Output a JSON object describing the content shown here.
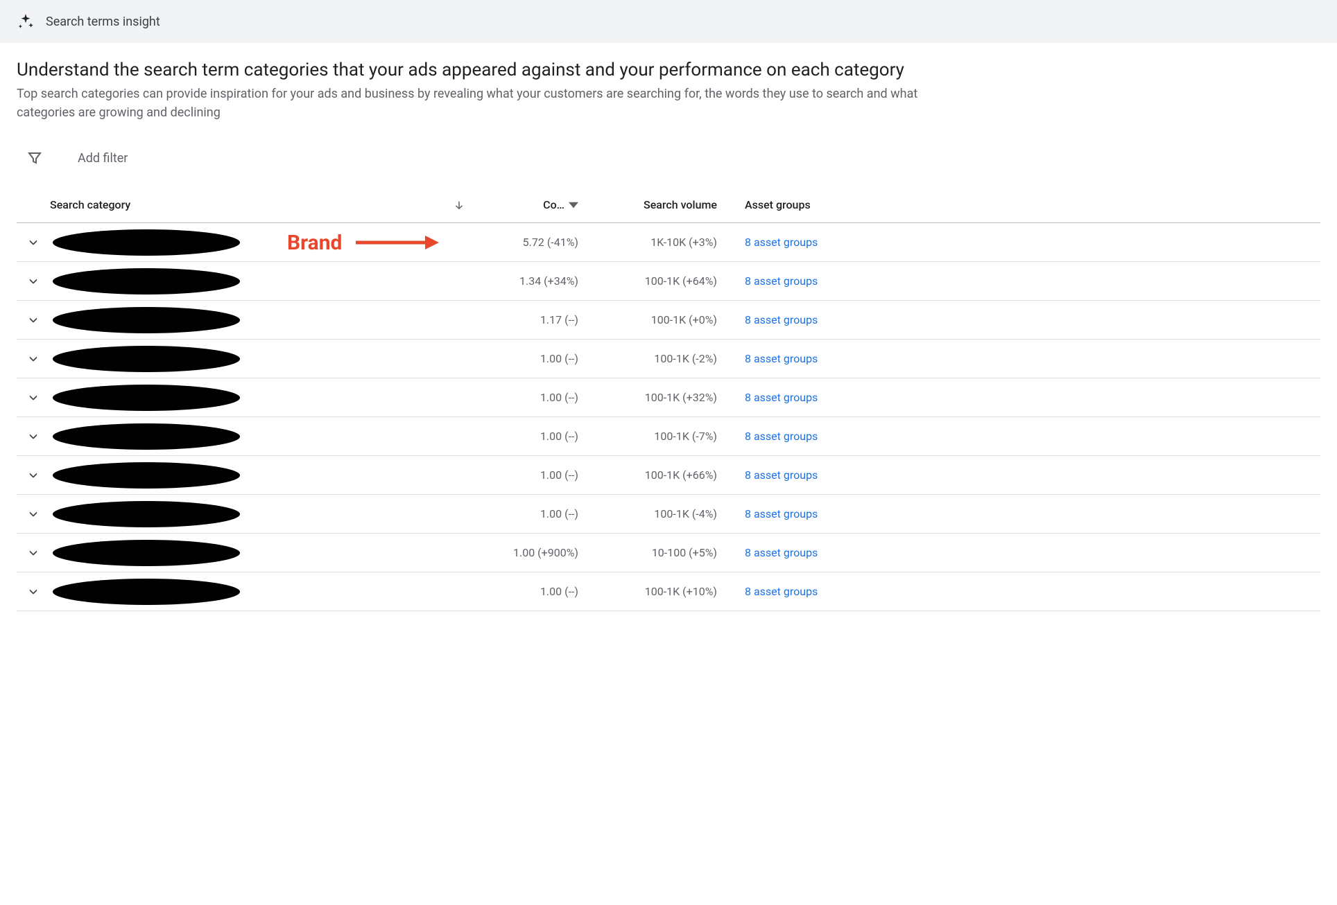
{
  "header": {
    "title": "Search terms insight"
  },
  "page": {
    "heading": "Understand the search term categories that your ads appeared against and your performance on each category",
    "subheading": "Top search categories can provide inspiration for your ads and business by revealing what your customers are searching for, the words they use to search and what categories are growing and declining"
  },
  "filter": {
    "label": "Add filter"
  },
  "columns": {
    "category": "Search category",
    "conv": "Co…",
    "volume": "Search volume",
    "groups": "Asset groups"
  },
  "annotation": {
    "label": "Brand"
  },
  "rows": [
    {
      "conv": "5.72 (-41%)",
      "volume": "1K-10K (+3%)",
      "groups": "8 asset groups"
    },
    {
      "conv": "1.34 (+34%)",
      "volume": "100-1K (+64%)",
      "groups": "8 asset groups"
    },
    {
      "conv": "1.17 (--)",
      "volume": "100-1K (+0%)",
      "groups": "8 asset groups"
    },
    {
      "conv": "1.00 (--)",
      "volume": "100-1K (-2%)",
      "groups": "8 asset groups"
    },
    {
      "conv": "1.00 (--)",
      "volume": "100-1K (+32%)",
      "groups": "8 asset groups"
    },
    {
      "conv": "1.00 (--)",
      "volume": "100-1K (-7%)",
      "groups": "8 asset groups"
    },
    {
      "conv": "1.00 (--)",
      "volume": "100-1K (+66%)",
      "groups": "8 asset groups"
    },
    {
      "conv": "1.00 (--)",
      "volume": "100-1K (-4%)",
      "groups": "8 asset groups"
    },
    {
      "conv": "1.00 (+900%)",
      "volume": "10-100 (+5%)",
      "groups": "8 asset groups"
    },
    {
      "conv": "1.00 (--)",
      "volume": "100-1K (+10%)",
      "groups": "8 asset groups"
    }
  ]
}
